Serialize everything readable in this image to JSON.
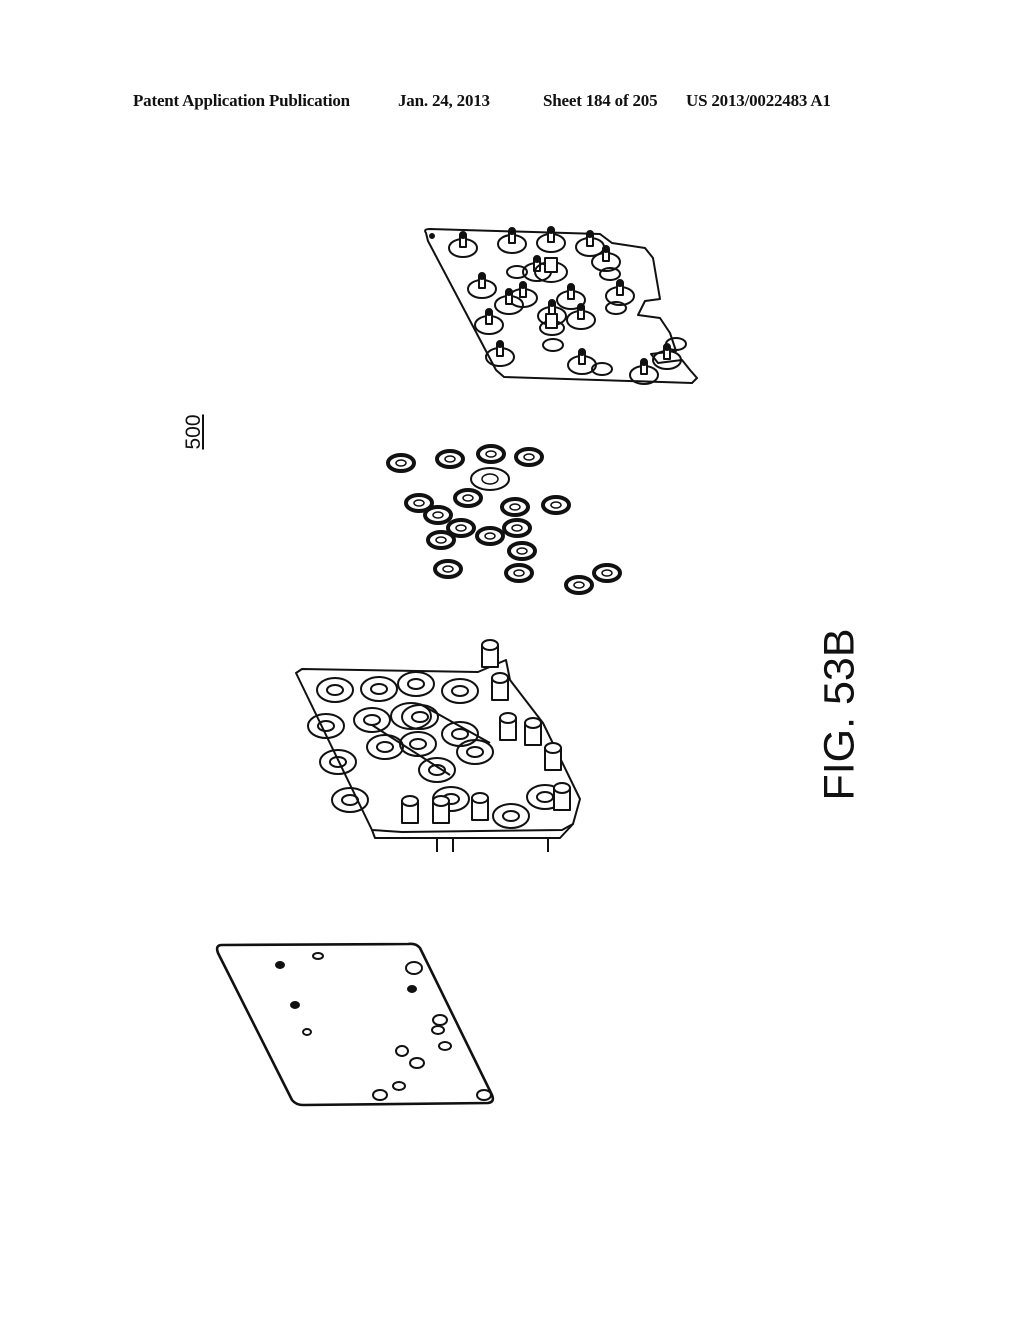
{
  "header": {
    "publication": "Patent Application Publication",
    "date": "Jan. 24, 2013",
    "sheet": "Sheet 184 of 205",
    "number": "US 2013/0022483 A1"
  },
  "figure": {
    "reference_numeral": "500",
    "label": "FIG. 53B",
    "orientation": "rotated 90° counter-clockwise",
    "components": [
      {
        "name": "top-plate-with-valve-stems",
        "description": "plate with valve stem fittings and notched edge"
      },
      {
        "name": "membrane-seals",
        "description": "array of individual elastomer seal rings / diaphragms"
      },
      {
        "name": "valve-body-manifold",
        "description": "molded manifold with valve seats, channels and cylindrical ports"
      },
      {
        "name": "bottom-cover-plate",
        "description": "flat plate with mounting holes"
      }
    ]
  },
  "colors": {
    "ink": "#111111",
    "paper": "#ffffff"
  }
}
